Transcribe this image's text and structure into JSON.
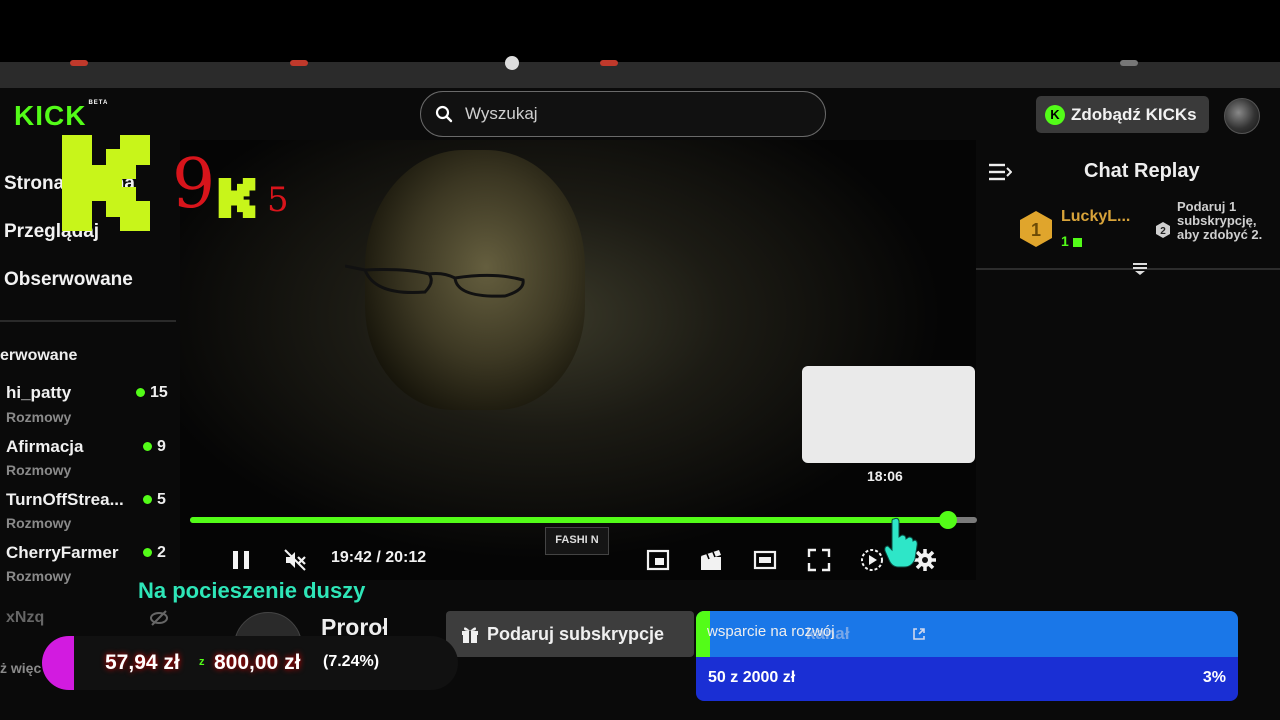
{
  "header": {
    "logo": "KICK",
    "logo_badge": "BETA",
    "search_placeholder": "Wyszukaj",
    "kicks_button": "Zdobądź KICKs"
  },
  "sidebar": {
    "nav": [
      {
        "label": "Strona główna"
      },
      {
        "label": "Przeglądaj"
      },
      {
        "label": "Obserwowane"
      }
    ],
    "section_heading": "erwowane",
    "channels": [
      {
        "name": "hi_patty",
        "category": "Rozmowy",
        "viewers": "15"
      },
      {
        "name": "Afirmacja",
        "category": "Rozmowy",
        "viewers": "9"
      },
      {
        "name": "TurnOffStrea...",
        "category": "Rozmowy",
        "viewers": "5"
      },
      {
        "name": "CherryFarmer",
        "category": "Rozmowy",
        "viewers": "2"
      }
    ],
    "offline_channel": "xNzq",
    "more_link": "ż więc"
  },
  "overlay": {
    "digit_main": "9",
    "digit_small": "5"
  },
  "chat": {
    "title": "Chat Replay",
    "leader_rank": "1",
    "leader_user": "LuckyL...",
    "leader_sub_count": "1",
    "next_rank": "2",
    "promo_text": "Podaruj 1 subskrypcję, aby zdobyć 2."
  },
  "player": {
    "preview_time": "18:06",
    "time_display": "19:42 / 20:12",
    "progress_fraction": 0.963,
    "shirt_text": "FASHI N"
  },
  "stream": {
    "tagline": "Na pocieszenie duszy",
    "streamer_name": "Proroł"
  },
  "gift": {
    "label": "Podaruj subskrypcje"
  },
  "donation": {
    "amount": "57,94 zł",
    "separator": "z",
    "goal": "800,00 zł",
    "percent": "(7.24%)"
  },
  "goal_widget": {
    "label": "wsparcie na rozwój",
    "ghost_label": "kanał",
    "progress_text": "50 z 2000 zł",
    "percent": "3%",
    "fill_fraction": 0.025
  },
  "colors": {
    "kick_green": "#53fc18",
    "goal_blue": "#1a77e8",
    "goal_dark_blue": "#1a2fd4",
    "tagline_teal": "#2ee6b8",
    "overlay_red": "#d8141b",
    "overlay_yellow": "#c8f51a"
  }
}
